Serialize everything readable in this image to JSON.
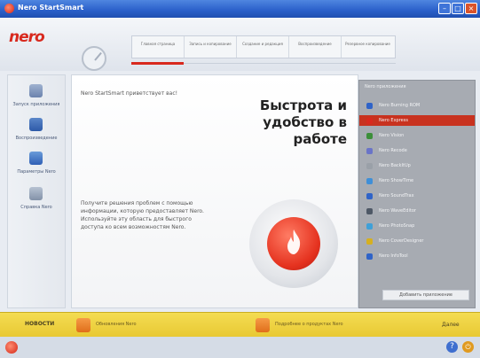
{
  "window": {
    "title": "Nero StartSmart"
  },
  "header": {
    "logo": "nero",
    "tabs": [
      {
        "label": "Главная страница"
      },
      {
        "label": "Запись и копирование"
      },
      {
        "label": "Создание и редакция"
      },
      {
        "label": "Воспроизведение"
      },
      {
        "label": "Резервное копирование"
      }
    ]
  },
  "sidebar": {
    "items": [
      {
        "label": "Запуск приложения",
        "icon": "apps-icon"
      },
      {
        "label": "Воспроизведение",
        "icon": "music-icon"
      },
      {
        "label": "Параметры Nero",
        "icon": "settings-icon"
      },
      {
        "label": "Справка Nero",
        "icon": "help-icon"
      }
    ]
  },
  "main": {
    "intro": "Nero StartSmart приветствует вас!",
    "headline_lines": [
      "Быстрота и",
      "удобство в",
      "работе"
    ],
    "description": "Получите решения проблем с помощью информации, которую предоставляет Nero. Используйте эту область для быстрого доступа ко всем возможностям Nero."
  },
  "rpanel": {
    "header": "Nero приложения",
    "items": [
      {
        "label": "Nero Burning ROM",
        "color": "#2f63c8"
      },
      {
        "label": "Nero Express",
        "color": "#d8291e",
        "selected": true
      },
      {
        "label": "Nero Vision",
        "color": "#3c8f3a"
      },
      {
        "label": "Nero Recode",
        "color": "#6a74c8"
      },
      {
        "label": "Nero BackItUp",
        "color": "#9aa0a8"
      },
      {
        "label": "Nero ShowTime",
        "color": "#3f8fd8"
      },
      {
        "label": "Nero SoundTrax",
        "color": "#2f63c8"
      },
      {
        "label": "Nero WaveEditor",
        "color": "#4e5866"
      },
      {
        "label": "Nero PhotoSnap",
        "color": "#3fa0d8"
      },
      {
        "label": "Nero CoverDesigner",
        "color": "#d6b020"
      },
      {
        "label": "Nero InfoTool",
        "color": "#2f63c8"
      }
    ],
    "button": "Добавить приложение"
  },
  "newsbar": {
    "label": "НОВОСТИ",
    "items": [
      {
        "text": "Обновления Nero"
      },
      {
        "text": "Подробнее о продуктах Nero"
      }
    ],
    "more": "Далее"
  },
  "colors": {
    "accent": "#d8291e",
    "titlebar": "#2a5fc9",
    "newsbar": "#f0d444",
    "panel": "#a7abb2"
  }
}
